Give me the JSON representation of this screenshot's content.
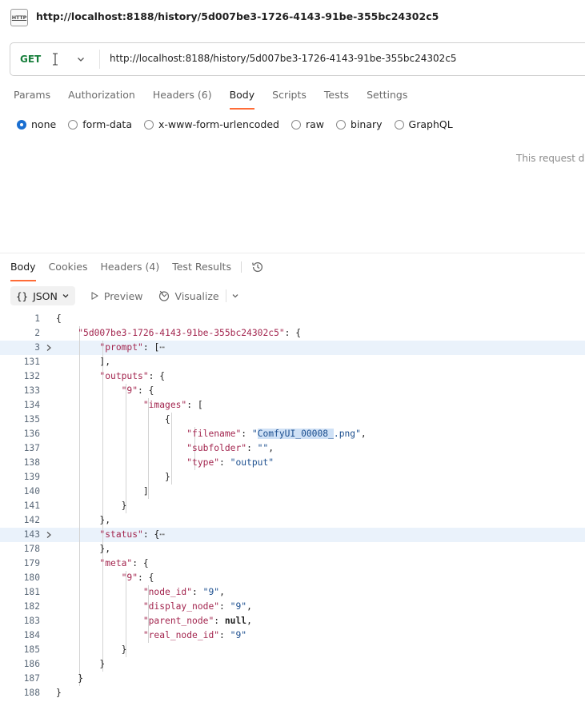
{
  "title": {
    "badge": "HTTP",
    "url": "http://localhost:8188/history/5d007be3-1726-4143-91be-355bc24302c5"
  },
  "request": {
    "method": "GET",
    "url": "http://localhost:8188/history/5d007be3-1726-4143-91be-355bc24302c5",
    "tabs": [
      "Params",
      "Authorization",
      "Headers (6)",
      "Body",
      "Scripts",
      "Tests",
      "Settings"
    ],
    "active_tab": "Body",
    "body_types": [
      "none",
      "form-data",
      "x-www-form-urlencoded",
      "raw",
      "binary",
      "GraphQL"
    ],
    "selected_body_type": "none",
    "no_body_message": "This request do"
  },
  "response": {
    "tabs": [
      "Body",
      "Cookies",
      "Headers (4)",
      "Test Results"
    ],
    "active_tab": "Body",
    "format": "JSON",
    "format_braces": "{}",
    "preview_label": "Preview",
    "visualize_label": "Visualize",
    "lines": [
      {
        "n": "1",
        "html": "<span class=\"p\">{</span>"
      },
      {
        "n": "2",
        "html": "    <span class=\"k\">\"5d007be3-1726-4143-91be-355bc24302c5\"</span><span class=\"p\">: {</span>"
      },
      {
        "n": "3",
        "html": "        <span class=\"k\">\"prompt\"</span><span class=\"p\">: [</span><span class=\"coll\">⋯</span>",
        "folded": true,
        "hl": true
      },
      {
        "n": "131",
        "html": "        <span class=\"p\">],</span>"
      },
      {
        "n": "132",
        "html": "        <span class=\"k\">\"outputs\"</span><span class=\"p\">: {</span>"
      },
      {
        "n": "133",
        "html": "            <span class=\"k\">\"9\"</span><span class=\"p\">: {</span>"
      },
      {
        "n": "134",
        "html": "                <span class=\"k\">\"images\"</span><span class=\"p\">: [</span>"
      },
      {
        "n": "135",
        "html": "                    <span class=\"p\">{</span>"
      },
      {
        "n": "136",
        "html": "                        <span class=\"k\">\"filename\"</span><span class=\"p\">: </span><span class=\"s\">\"<span class=\"sel\">ComfyUI_00008_</span>.png\"</span><span class=\"p\">,</span>",
        "bold": true
      },
      {
        "n": "137",
        "html": "                        <span class=\"k\">\"subfolder\"</span><span class=\"p\">: </span><span class=\"s\">\"\"</span><span class=\"p\">,</span>"
      },
      {
        "n": "138",
        "html": "                        <span class=\"k\">\"type\"</span><span class=\"p\">: </span><span class=\"s\">\"output\"</span>"
      },
      {
        "n": "139",
        "html": "                    <span class=\"p\">}</span>"
      },
      {
        "n": "140",
        "html": "                <span class=\"p\">]</span>"
      },
      {
        "n": "141",
        "html": "            <span class=\"p\">}</span>"
      },
      {
        "n": "142",
        "html": "        <span class=\"p\">},</span>"
      },
      {
        "n": "143",
        "html": "        <span class=\"k\">\"status\"</span><span class=\"p\">: {</span><span class=\"coll\">⋯</span>",
        "folded": true,
        "hl": true
      },
      {
        "n": "178",
        "html": "        <span class=\"p\">},</span>"
      },
      {
        "n": "179",
        "html": "        <span class=\"k\">\"meta\"</span><span class=\"p\">: {</span>"
      },
      {
        "n": "180",
        "html": "            <span class=\"k\">\"9\"</span><span class=\"p\">: {</span>"
      },
      {
        "n": "181",
        "html": "                <span class=\"k\">\"node_id\"</span><span class=\"p\">: </span><span class=\"s\">\"9\"</span><span class=\"p\">,</span>"
      },
      {
        "n": "182",
        "html": "                <span class=\"k\">\"display_node\"</span><span class=\"p\">: </span><span class=\"s\">\"9\"</span><span class=\"p\">,</span>"
      },
      {
        "n": "183",
        "html": "                <span class=\"k\">\"parent_node\"</span><span class=\"p\">: </span><span class=\"nl\">null</span><span class=\"p\">,</span>"
      },
      {
        "n": "184",
        "html": "                <span class=\"k\">\"real_node_id\"</span><span class=\"p\">: </span><span class=\"s\">\"9\"</span>"
      },
      {
        "n": "185",
        "html": "            <span class=\"p\">}</span>"
      },
      {
        "n": "186",
        "html": "        <span class=\"p\">}</span>"
      },
      {
        "n": "187",
        "html": "    <span class=\"p\">}</span>"
      },
      {
        "n": "188",
        "html": "<span class=\"p\">}</span>"
      }
    ]
  },
  "colors": {
    "accent_tab": "#ff6c37",
    "method_get": "#177e3b",
    "radio_selected": "#1a6fd1",
    "json_key": "#a3264f",
    "json_string": "#1c4f8f",
    "fold_highlight": "#eaf2fb"
  }
}
